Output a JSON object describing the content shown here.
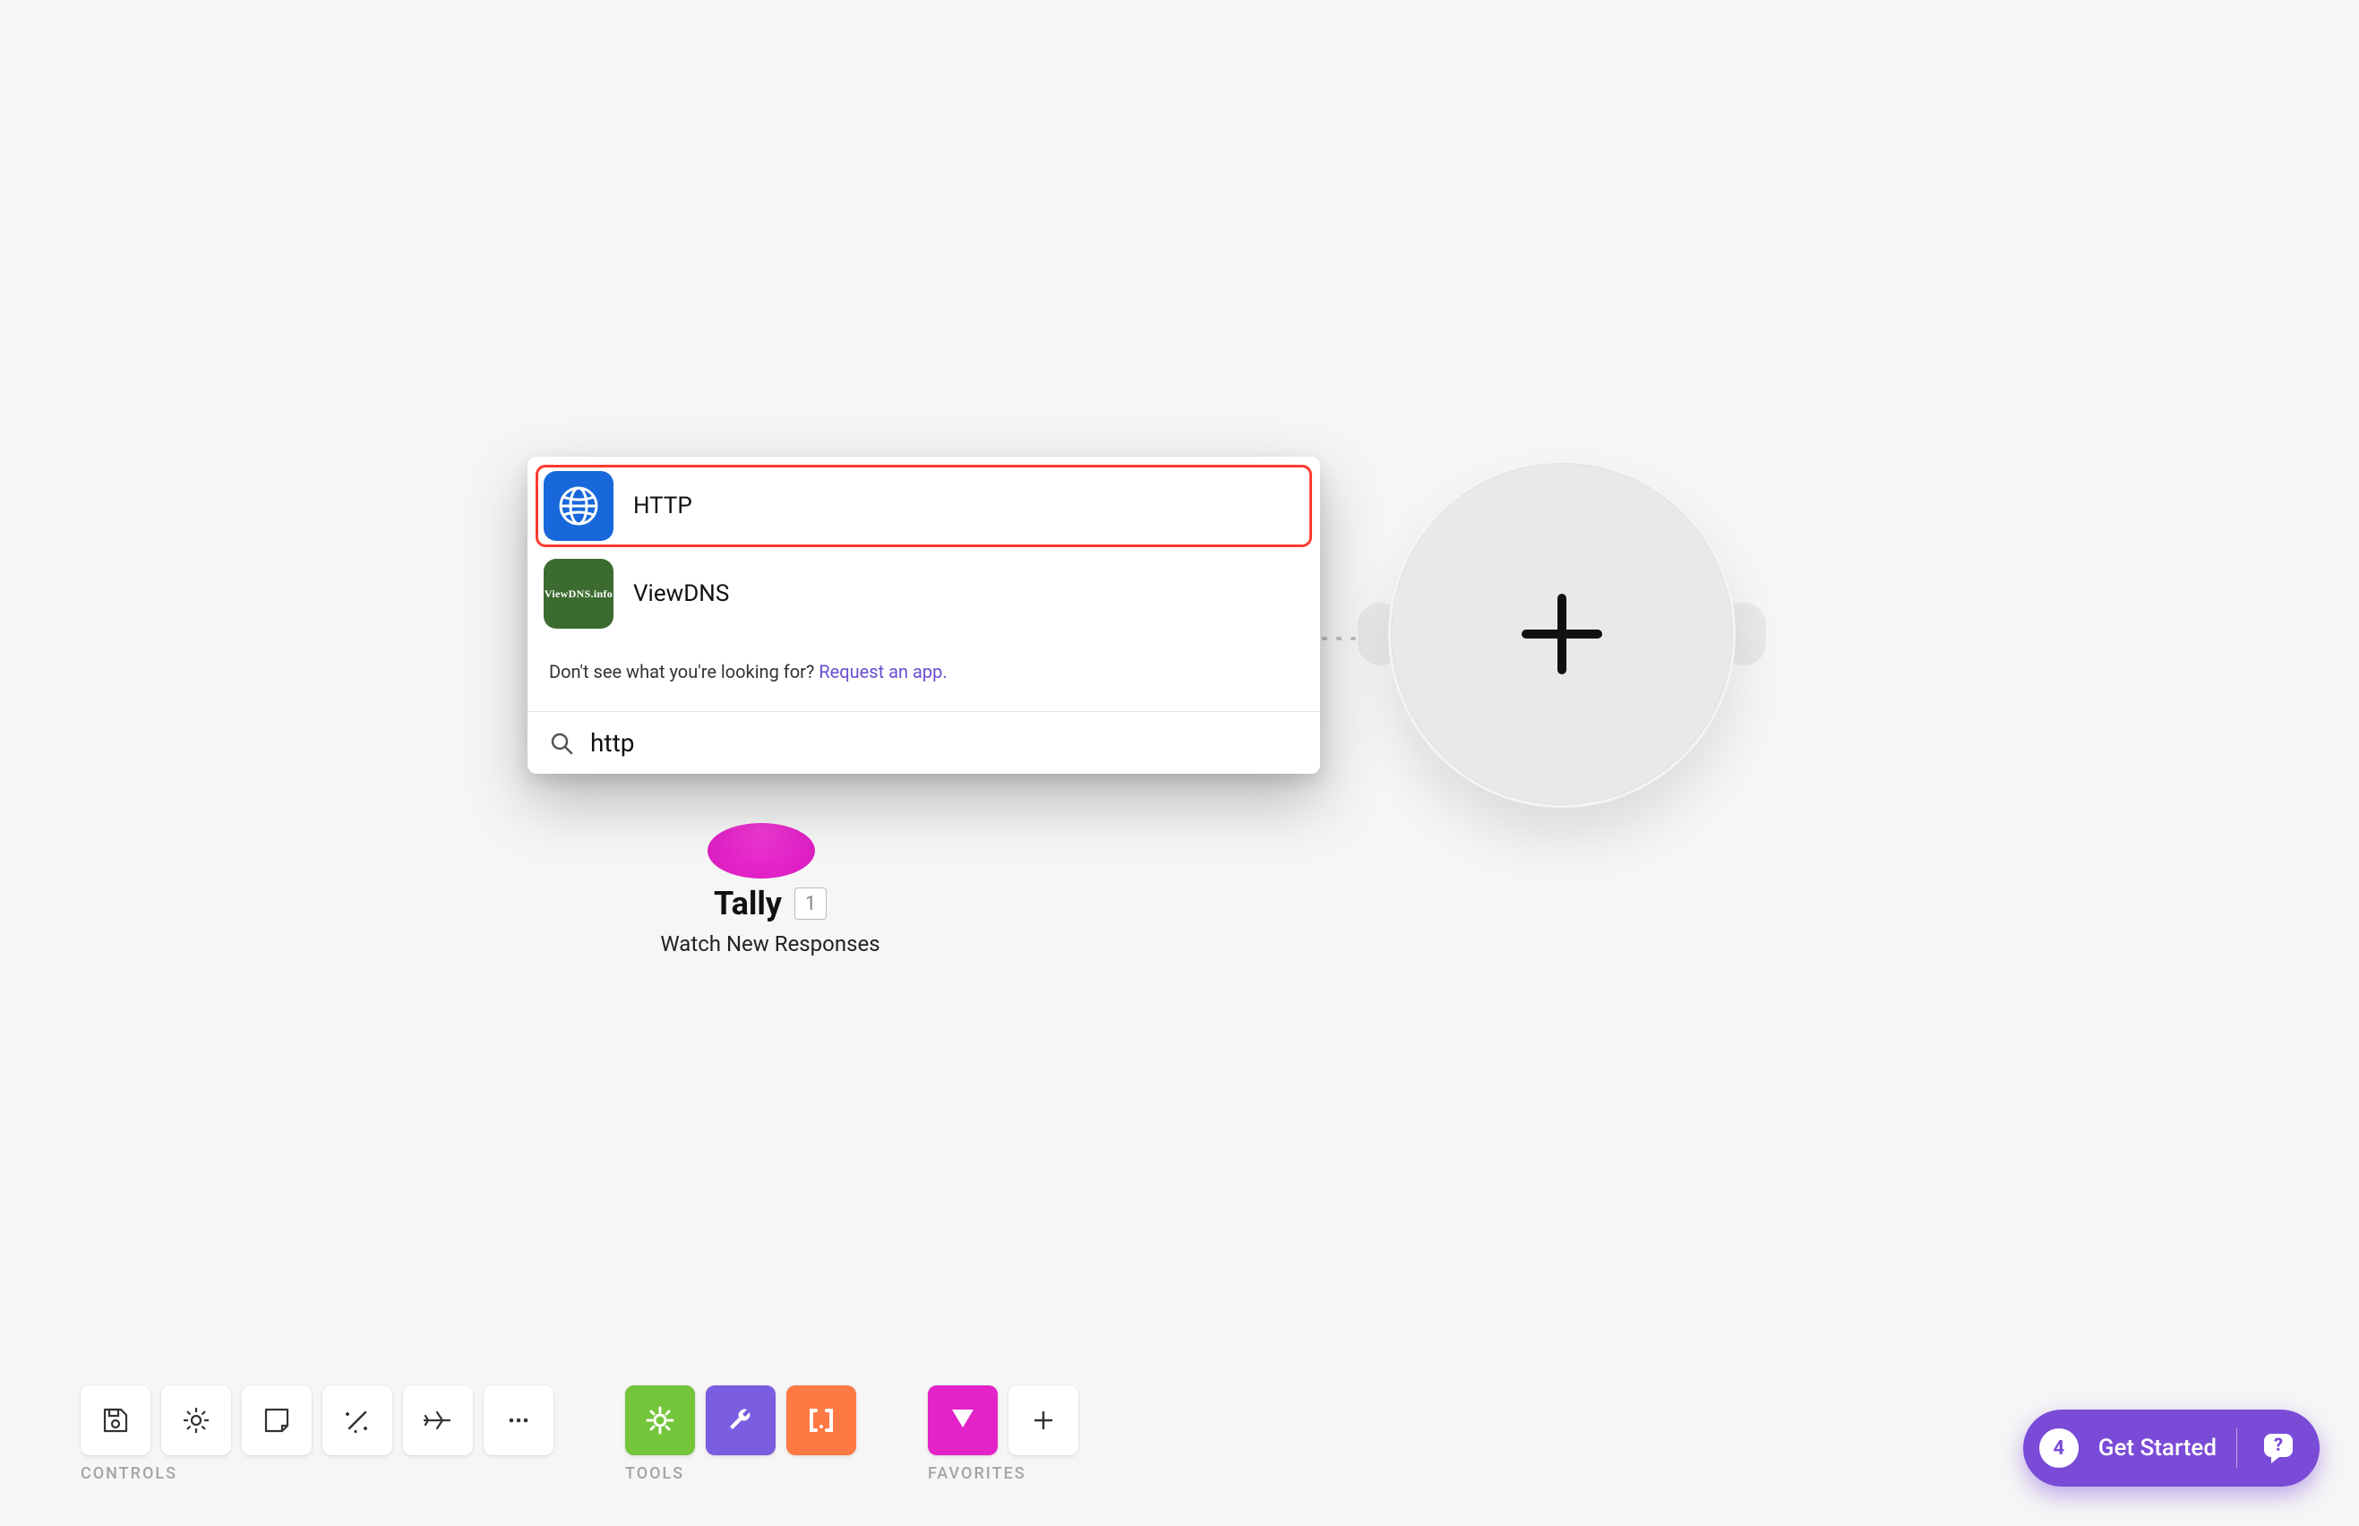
{
  "node": {
    "name": "Tally",
    "badge": "1",
    "subtitle": "Watch New Responses"
  },
  "popup": {
    "results": [
      {
        "id": "http",
        "label": "HTTP",
        "icon": "globe-icon"
      },
      {
        "id": "viewdns",
        "label": "ViewDNS",
        "icon": "viewdns-icon"
      }
    ],
    "footer_prefix": "Don't see what you're looking for? ",
    "footer_link": "Request an app.",
    "search_value": "http"
  },
  "toolbar": {
    "controls_label": "CONTROLS",
    "tools_label": "TOOLS",
    "favorites_label": "FAVORITES"
  },
  "help": {
    "count": "4",
    "label": "Get Started"
  }
}
